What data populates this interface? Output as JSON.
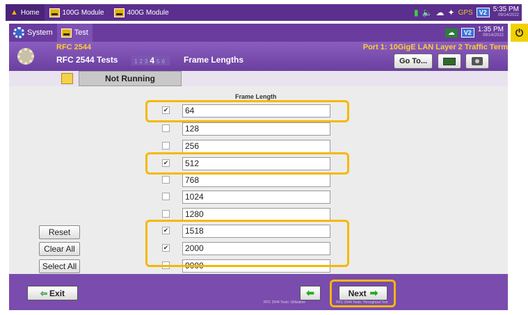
{
  "os_bar": {
    "tabs": [
      {
        "label": "Home"
      },
      {
        "label": "100G Module"
      },
      {
        "label": "400G Module"
      }
    ],
    "time": "5:35 PM",
    "date": "09/14/2022",
    "status_icons": [
      "battery-charging-icon",
      "speaker-icon",
      "cloud-icon",
      "satellite-icon",
      "gps-icon",
      "v2-icon"
    ],
    "gps_label": "GPS",
    "v2_label": "V2"
  },
  "app_header": {
    "tabs": [
      {
        "label": "System"
      },
      {
        "label": "Test"
      }
    ],
    "v2_label": "V2",
    "time": "1:35 PM",
    "date": "09/14/2022",
    "power_glyph": "⏻"
  },
  "test_bar": {
    "test_name": "RFC 2544",
    "subtitle": "RFC 2544 Tests",
    "steps": [
      "1",
      "2",
      "3",
      "4",
      "5",
      "6"
    ],
    "current_step": "4",
    "step_title": "Frame Lengths",
    "port_label": "Port 1: 10GigE LAN Layer 2 Traffic Term",
    "goto_label": "Go To..."
  },
  "status": {
    "text": "Not Running"
  },
  "frame_lengths": {
    "column_header": "Frame Length",
    "rows": [
      {
        "value": "64",
        "checked": true
      },
      {
        "value": "128",
        "checked": false
      },
      {
        "value": "256",
        "checked": false
      },
      {
        "value": "512",
        "checked": true
      },
      {
        "value": "768",
        "checked": false
      },
      {
        "value": "1024",
        "checked": false
      },
      {
        "value": "1280",
        "checked": false
      },
      {
        "value": "1518",
        "checked": true
      },
      {
        "value": "2000",
        "checked": true
      },
      {
        "value": "9000",
        "checked": false
      }
    ]
  },
  "side_buttons": {
    "reset": "Reset",
    "clear_all": "Clear All",
    "select_all": "Select All"
  },
  "footer": {
    "exit_label": "Exit",
    "next_label": "Next",
    "prev_step_label": "RFC 2544 Tests: Utilization",
    "next_step_label": "RFC 2544 Tests: Throughput Test"
  },
  "colors": {
    "header_purple": "#6a3c9e",
    "highlight": "#f5b800",
    "accent_yellow": "#ffcc33",
    "arrow_green": "#22a822"
  }
}
